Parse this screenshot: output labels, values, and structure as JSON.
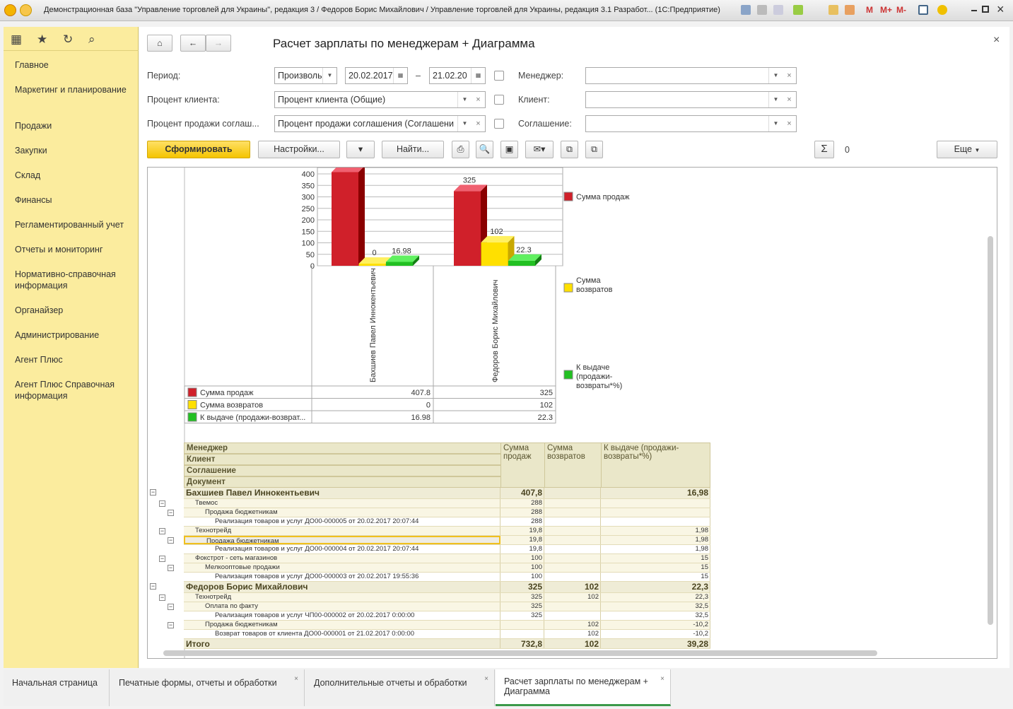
{
  "window": {
    "title": "Демонстрационная база \"Управление торговлей для Украины\", редакция 3 / Федоров Борис Михайлович / Управление торговлей для Украины, редакция 3.1 Разработ... (1С:Предприятие)",
    "m_labels": [
      "M",
      "M+",
      "M-"
    ]
  },
  "sidebar": {
    "items": [
      "Главное",
      "Маркетинг и планирование",
      "Продажи",
      "Закупки",
      "Склад",
      "Финансы",
      "Регламентированный учет",
      "Отчеты и мониторинг",
      "Нормативно-справочная информация",
      "Органайзер",
      "Администрирование",
      "Агент Плюс",
      "Агент Плюс Справочная информация"
    ]
  },
  "form": {
    "title": "Расчет зарплаты по менеджерам + Диаграмма",
    "period_label": "Период:",
    "period_type": "Произволь",
    "date_from": "20.02.2017",
    "dash": "–",
    "date_to": "21.02.20",
    "client_pct_label": "Процент клиента:",
    "client_pct_value": "Процент клиента (Общие)",
    "agreement_pct_label": "Процент продажи соглаш...",
    "agreement_pct_value": "Процент продажи соглашения (Соглашени",
    "manager_label": "Менеджер:",
    "client_label": "Клиент:",
    "agreement_label": "Соглашение:",
    "generate": "Сформировать",
    "settings": "Настройки...",
    "find": "Найти...",
    "sum_value": "0",
    "more": "Еще",
    "sum_symbol": "Σ"
  },
  "chart_data": {
    "type": "bar",
    "categories": [
      "Бахшиев Павел Иннокентьевич",
      "Федоров Борис Михайлович"
    ],
    "series": [
      {
        "name": "Сумма продаж",
        "legend_name": "Сумма продаж",
        "color": "#d0202a",
        "values": [
          407.8,
          325
        ],
        "labels": [
          "",
          "325"
        ]
      },
      {
        "name": "Сумма возвратов",
        "legend_name": "Сумма возвратов",
        "color": "#ffe000",
        "values": [
          0,
          102
        ],
        "labels": [
          "0",
          "102"
        ]
      },
      {
        "name": "К выдаче (продажи-возврат...",
        "legend_name": "К выдаче (продажи-возвраты*%)",
        "color": "#22c022",
        "values": [
          16.98,
          22.3
        ],
        "labels": [
          "16.98",
          "22.3"
        ]
      }
    ],
    "table_values": [
      [
        "407.8",
        "325"
      ],
      [
        "0",
        "102"
      ],
      [
        "16.98",
        "22.3"
      ]
    ],
    "yticks": [
      "0",
      "50",
      "100",
      "150",
      "200",
      "250",
      "300",
      "350",
      "400"
    ],
    "ylim": [
      0,
      400
    ],
    "grid": true,
    "legend": "right"
  },
  "report": {
    "headers": {
      "manager": "Менеджер",
      "client": "Клиент",
      "agreement": "Соглашение",
      "document": "Документ",
      "sales": "Сумма продаж",
      "returns": "Сумма возвратов",
      "payout": "К выдаче (продажи-возвраты*%)"
    },
    "rows": [
      {
        "level": 0,
        "name": "Бахшиев Павел Иннокентьевич",
        "sales": "407,8",
        "returns": "",
        "payout": "16,98"
      },
      {
        "level": 1,
        "name": "Твемос",
        "sales": "288",
        "returns": "",
        "payout": ""
      },
      {
        "level": 2,
        "name": "Продажа бюджетникам",
        "sales": "288",
        "returns": "",
        "payout": ""
      },
      {
        "level": 3,
        "name": "Реализация товаров и услуг ДО00-000005 от 20.02.2017 20:07:44",
        "sales": "288",
        "returns": "",
        "payout": ""
      },
      {
        "level": 1,
        "name": "Технотрейд",
        "sales": "19,8",
        "returns": "",
        "payout": "1,98"
      },
      {
        "level": 2,
        "name": "Продажа бюджетникам",
        "sales": "19,8",
        "returns": "",
        "payout": "1,98",
        "selected": true
      },
      {
        "level": 3,
        "name": "Реализация товаров и услуг ДО00-000004 от 20.02.2017 20:07:44",
        "sales": "19,8",
        "returns": "",
        "payout": "1,98"
      },
      {
        "level": 1,
        "name": "Фокстрот - сеть магазинов",
        "sales": "100",
        "returns": "",
        "payout": "15"
      },
      {
        "level": 2,
        "name": "Мелкооптовые продажи",
        "sales": "100",
        "returns": "",
        "payout": "15"
      },
      {
        "level": 3,
        "name": "Реализация товаров и услуг ДО00-000003 от 20.02.2017 19:55:36",
        "sales": "100",
        "returns": "",
        "payout": "15"
      },
      {
        "level": 0,
        "name": "Федоров Борис Михайлович",
        "sales": "325",
        "returns": "102",
        "payout": "22,3"
      },
      {
        "level": 1,
        "name": "Технотрейд",
        "sales": "325",
        "returns": "102",
        "payout": "22,3"
      },
      {
        "level": 2,
        "name": "Оплата по факту",
        "sales": "325",
        "returns": "",
        "payout": "32,5"
      },
      {
        "level": 3,
        "name": "Реализация товаров и услуг ЧП00-000002 от 20.02.2017 0:00:00",
        "sales": "325",
        "returns": "",
        "payout": "32,5"
      },
      {
        "level": 2,
        "name": "Продажа бюджетникам",
        "sales": "",
        "returns": "102",
        "payout": "-10,2"
      },
      {
        "level": 3,
        "name": "Возврат товаров от клиента ДО00-000001 от 21.02.2017 0:00:00",
        "sales": "",
        "returns": "102",
        "payout": "-10,2"
      },
      {
        "level": 0,
        "name": "Итого",
        "sales": "732,8",
        "returns": "102",
        "payout": "39,28"
      }
    ]
  },
  "tabs": [
    {
      "label": "Начальная страница"
    },
    {
      "label": "Печатные формы, отчеты и обработки"
    },
    {
      "label": "Дополнительные отчеты и обработки"
    },
    {
      "label": "Расчет зарплаты по менеджерам + Диаграмма"
    }
  ],
  "close_symbol": "×"
}
